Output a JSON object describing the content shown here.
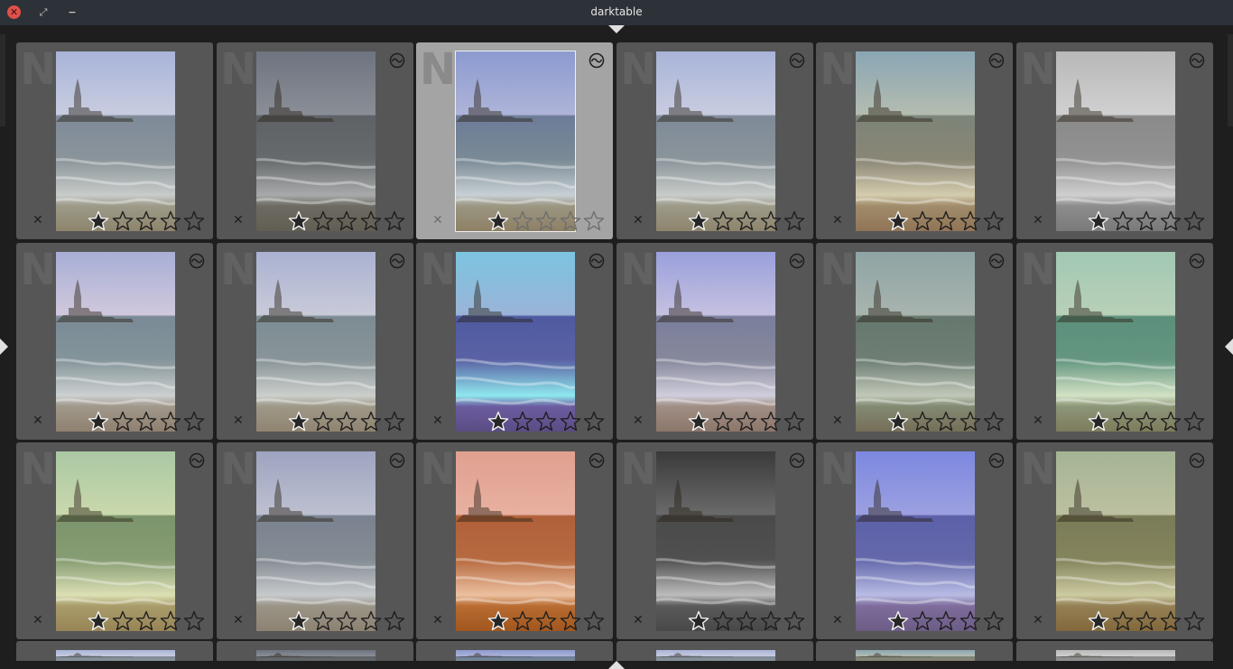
{
  "window": {
    "title": "darktable"
  },
  "window_buttons": [
    {
      "name": "window-close-button",
      "glyph": "✕"
    },
    {
      "name": "window-maximize-button",
      "glyph": "⤢"
    },
    {
      "name": "window-minimize-button",
      "glyph": "−"
    }
  ],
  "panel_toggles": [
    {
      "name": "top-panel-toggle-arrow",
      "icon": "triangle-down-icon"
    },
    {
      "name": "bottom-panel-toggle-arrow",
      "icon": "triangle-up-icon"
    },
    {
      "name": "left-panel-toggle-arrow",
      "icon": "triangle-right-icon"
    },
    {
      "name": "right-panel-toggle-arrow",
      "icon": "triangle-left-icon"
    }
  ],
  "lighttable": {
    "columns": 6,
    "thumb_ext_label": "N",
    "reject_glyph": "✕",
    "selected_index": 2,
    "icons": {
      "altered": "altered-history-icon",
      "star": "star-icon",
      "reject": "reject-x-icon"
    },
    "colors": {
      "star_fill": "#262626",
      "star_stroke": "#1e1e1e",
      "thumb_bg": "#565656",
      "thumb_selected_bg": "#a4a4a4"
    },
    "thumbnails": [
      {
        "rating": 1,
        "altered": false,
        "tone": "natural"
      },
      {
        "rating": 1,
        "altered": true,
        "tone": "dim"
      },
      {
        "rating": 1,
        "altered": true,
        "tone": "cool"
      },
      {
        "rating": 1,
        "altered": true,
        "tone": "natural"
      },
      {
        "rating": 1,
        "altered": true,
        "tone": "warm-vintage"
      },
      {
        "rating": 1,
        "altered": true,
        "tone": "monochrome-light"
      },
      {
        "rating": 1,
        "altered": true,
        "tone": "natural-pink"
      },
      {
        "rating": 1,
        "altered": true,
        "tone": "natural-pale"
      },
      {
        "rating": 1,
        "altered": true,
        "tone": "cyan-purple"
      },
      {
        "rating": 1,
        "altered": true,
        "tone": "natural-purple"
      },
      {
        "rating": 1,
        "altered": true,
        "tone": "muted-green"
      },
      {
        "rating": 1,
        "altered": true,
        "tone": "green"
      },
      {
        "rating": 1,
        "altered": true,
        "tone": "yellow-green"
      },
      {
        "rating": 1,
        "altered": true,
        "tone": "faded"
      },
      {
        "rating": 1,
        "altered": true,
        "tone": "orange"
      },
      {
        "rating": 1,
        "altered": true,
        "tone": "monochrome-dark"
      },
      {
        "rating": 1,
        "altered": true,
        "tone": "blue-purple"
      },
      {
        "rating": 1,
        "altered": true,
        "tone": "olive"
      }
    ],
    "partial_row_count": 6
  }
}
